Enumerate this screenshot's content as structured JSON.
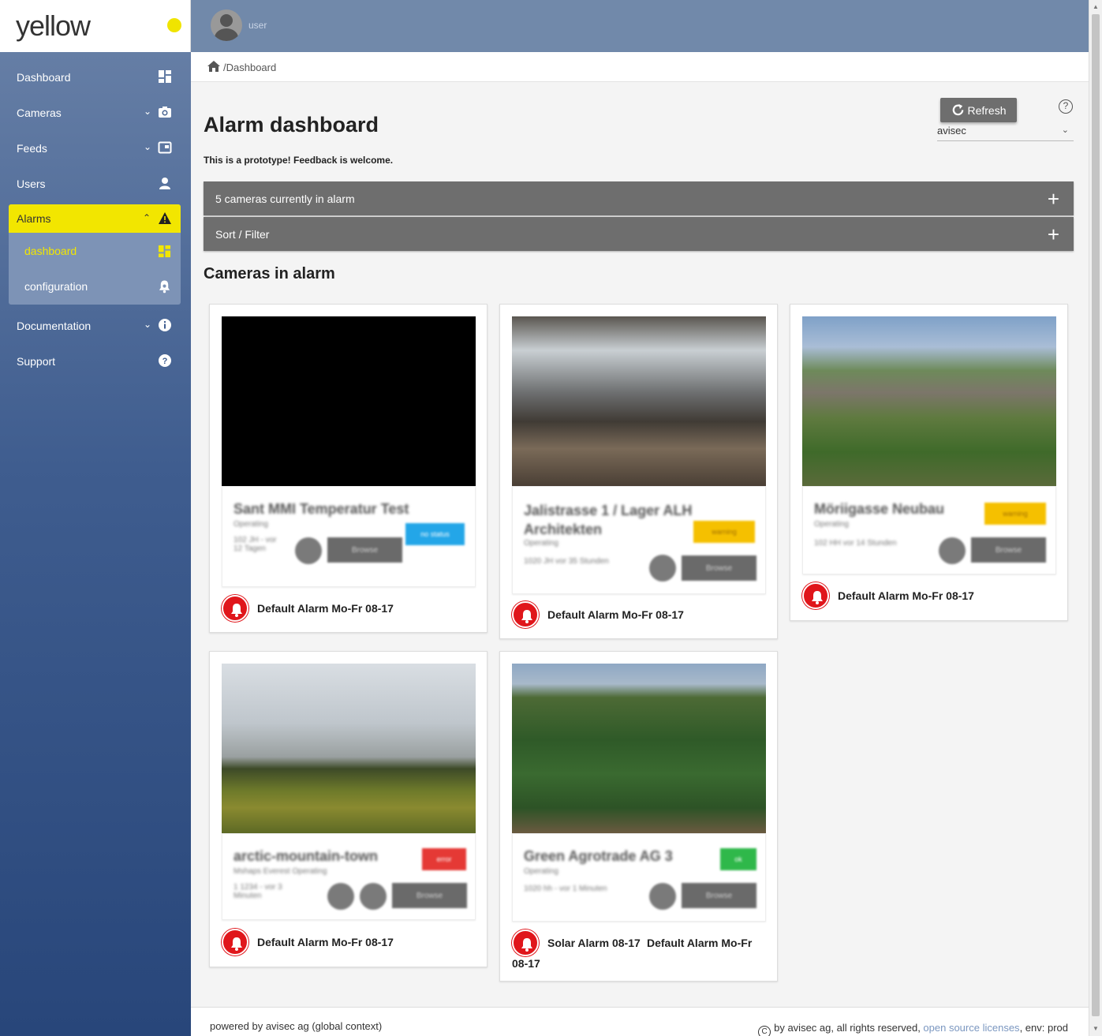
{
  "app": {
    "logo_text": "yellow",
    "username": "user"
  },
  "sidebar": {
    "items": [
      {
        "label": "Dashboard"
      },
      {
        "label": "Cameras"
      },
      {
        "label": "Feeds"
      },
      {
        "label": "Users"
      },
      {
        "label": "Alarms"
      },
      {
        "label": "Documentation"
      },
      {
        "label": "Support"
      }
    ],
    "alarms_sub": [
      {
        "label": "dashboard"
      },
      {
        "label": "configuration"
      }
    ]
  },
  "breadcrumb": {
    "path": "/Dashboard"
  },
  "header": {
    "title": "Alarm dashboard",
    "subtitle": "This is a prototype! Feedback is welcome.",
    "refresh_label": "Refresh",
    "account": "avisec"
  },
  "accordions": [
    {
      "label": "5 cameras currently in alarm"
    },
    {
      "label": "Sort / Filter"
    }
  ],
  "section_title": "Cameras in alarm",
  "cards": [
    {
      "name": "Sant MMI Temperatur Test",
      "sub": "Operating",
      "meta": "102 JH - vor 12 Tagen",
      "badge": "no status",
      "badge_color": "#23a6e8",
      "browse": "Browse",
      "alarm": "Default Alarm Mo-Fr 08-17"
    },
    {
      "name": "Jalistrasse 1 / Lager ALH Architekten",
      "sub": "Operating",
      "meta": "1020 JH vor 35 Stunden",
      "badge": "warning",
      "badge_color": "#f5c000",
      "browse": "Browse",
      "alarm": "Default Alarm Mo-Fr 08-17"
    },
    {
      "name": "Möriigasse Neubau",
      "sub": "Operating",
      "meta": "102 HH vor 14 Stunden",
      "badge": "warning",
      "badge_color": "#f5c000",
      "browse": "Browse",
      "alarm": "Default Alarm Mo-Fr 08-17"
    },
    {
      "name": "arctic-mountain-town",
      "sub": "Mshaps Everest Operating",
      "meta": "1 1234 - vor 3 Minuten",
      "badge": "error",
      "badge_color": "#e53935",
      "browse": "Browse",
      "alarm": "Default Alarm Mo-Fr 08-17"
    },
    {
      "name": "Green Agrotrade AG 3",
      "sub": "Operating",
      "meta": "1020 hh - vor 1 Minuten",
      "badge": "ok",
      "badge_color": "#2fb84a",
      "browse": "Browse",
      "alarm_primary": "Solar Alarm 08-17",
      "alarm_secondary": "Default Alarm Mo-Fr",
      "alarm_tail": "08-17"
    }
  ],
  "footer": {
    "left": "powered by avisec ag (global context)",
    "right_prefix": "by avisec ag, all rights reserved, ",
    "licenses_link": "open source licenses",
    "right_suffix": ", env: prod"
  },
  "colors": {
    "accent": "#f2e600",
    "sidebar_top": "#6a82a8",
    "sidebar_bottom": "#28467a",
    "alarm_red": "#e0161b"
  }
}
